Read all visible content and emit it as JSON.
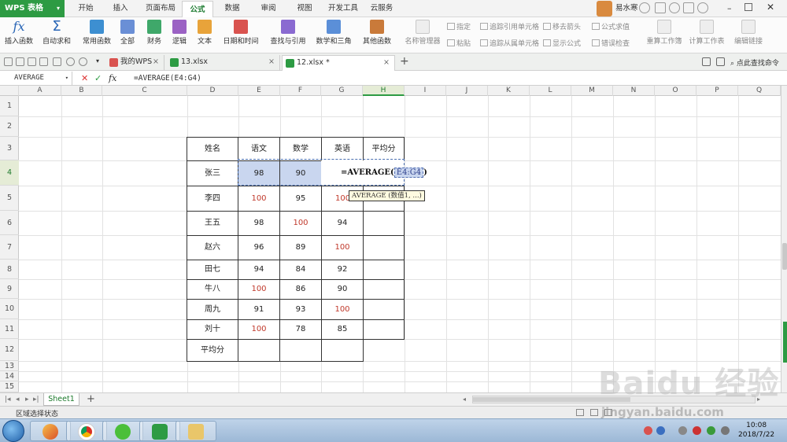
{
  "app": {
    "name": "WPS 表格"
  },
  "menu": [
    "开始",
    "插入",
    "页面布局",
    "公式",
    "数据",
    "审阅",
    "视图",
    "开发工具",
    "云服务"
  ],
  "menu_active_index": 3,
  "user": {
    "name": "易水寒"
  },
  "ribbon": {
    "buttons": [
      "插入函数",
      "自动求和",
      "常用函数",
      "全部",
      "财务",
      "逻辑",
      "文本",
      "日期和时间",
      "查找与引用",
      "数学和三角",
      "其他函数",
      "名称管理器"
    ],
    "small": [
      "指定",
      "粘贴",
      "追踪引用单元格",
      "追踪从属单元格",
      "移去箭头",
      "显示公式",
      "公式求值",
      "错误检查"
    ],
    "right": [
      "重算工作簿",
      "计算工作表",
      "编辑链接"
    ]
  },
  "tabs": [
    {
      "label": "我的WPS"
    },
    {
      "label": "13.xlsx"
    },
    {
      "label": "12.xlsx *"
    }
  ],
  "search": {
    "label": "点此查找命令"
  },
  "formula_bar": {
    "name_box": "AVERAGE",
    "cancel": "✕",
    "confirm": "✓",
    "fx": "fx",
    "formula": "=AVERAGE(E4:G4)"
  },
  "columns": [
    "A",
    "B",
    "C",
    "D",
    "E",
    "F",
    "G",
    "H",
    "I",
    "J",
    "K",
    "L",
    "M",
    "N",
    "O",
    "P",
    "Q"
  ],
  "rows": [
    "1",
    "2",
    "3",
    "4",
    "5",
    "6",
    "7",
    "8",
    "9",
    "10",
    "11",
    "12",
    "13",
    "14",
    "15"
  ],
  "table": {
    "headers": [
      "姓名",
      "语文",
      "数学",
      "英语",
      "平均分"
    ],
    "rows": [
      {
        "name": "张三",
        "chinese": "98",
        "math": "90",
        "english": ""
      },
      {
        "name": "李四",
        "chinese": "100",
        "math": "95",
        "english": "100"
      },
      {
        "name": "王五",
        "chinese": "98",
        "math": "100",
        "english": "94"
      },
      {
        "name": "赵六",
        "chinese": "96",
        "math": "89",
        "english": "100"
      },
      {
        "name": "田七",
        "chinese": "94",
        "math": "84",
        "english": "92"
      },
      {
        "name": "牛八",
        "chinese": "100",
        "math": "86",
        "english": "90"
      },
      {
        "name": "周九",
        "chinese": "91",
        "math": "93",
        "english": "100"
      },
      {
        "name": "刘十",
        "chinese": "100",
        "math": "78",
        "english": "85"
      }
    ],
    "footer_label": "平均分",
    "edit_prefix": "=AVERAGE(",
    "edit_ref": "E4:G4",
    "edit_suffix": ")",
    "tooltip": "AVERAGE (数值1, ...)"
  },
  "sheets": [
    "Sheet1"
  ],
  "status": {
    "text": "区域选择状态"
  },
  "clock": {
    "time": "10:08",
    "date": "2018/7/22"
  },
  "watermark": {
    "text": "Baidu 经验",
    "sub": "jingyan.baidu.com"
  },
  "colors": {
    "accent": "#2d9b43",
    "selection": "#c9d6ef",
    "red_values": "#c0392b"
  }
}
